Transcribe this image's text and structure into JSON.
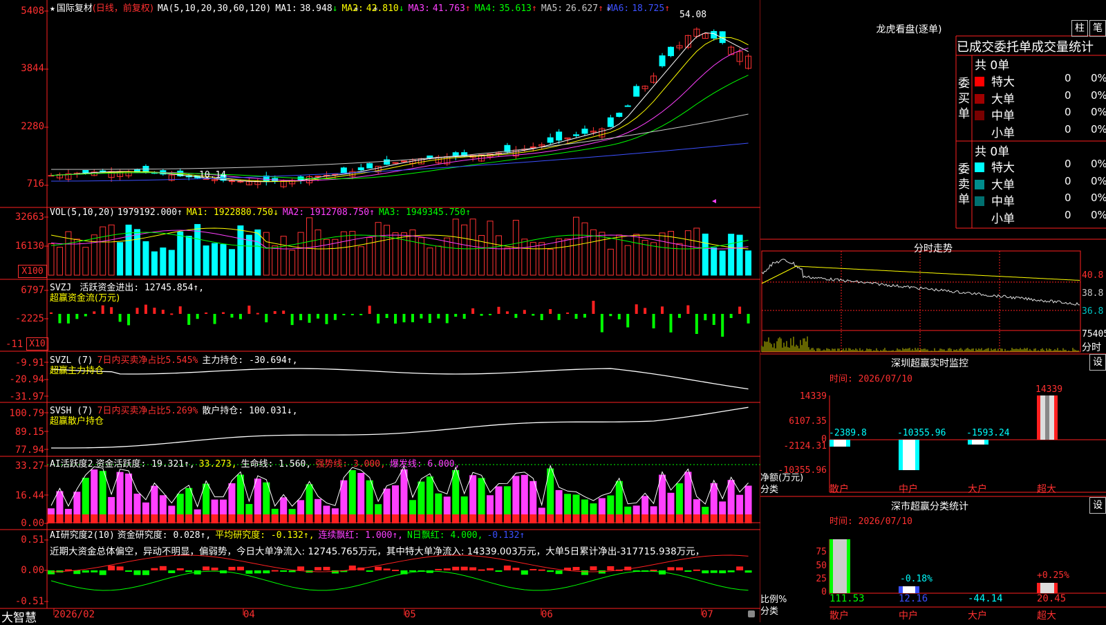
{
  "app_name": "大智慧",
  "kline": {
    "star": "★",
    "title": "国际复材",
    "mode": "(日线，前复权)",
    "ma_label": "MA(5,10,20,30,60,120)",
    "ma": [
      {
        "label": "MA1:",
        "value": "38.948",
        "arrow": "↓",
        "color": "#ffffff"
      },
      {
        "label": "MA2:",
        "value": "42.810",
        "arrow": "↓",
        "color": "#ffff00"
      },
      {
        "label": "MA3:",
        "value": "41.763",
        "arrow": "↑",
        "color": "#ff40ff"
      },
      {
        "label": "MA4:",
        "value": "35.613",
        "arrow": "↑",
        "color": "#00ff00"
      },
      {
        "label": "MA5:",
        "value": "26.627",
        "arrow": "↑",
        "color": "#c8c8c8"
      },
      {
        "label": "MA6:",
        "value": "18.725",
        "arrow": "↑",
        "color": "#3c50ff"
      }
    ],
    "y_ticks": [
      "5408",
      "3844",
      "2280",
      "716"
    ],
    "high_label": "54.08",
    "low_label": "10.14",
    "colors": {
      "up": "#ff3232",
      "down": "#00ffff"
    }
  },
  "vol": {
    "label": "VOL(5,10,20)",
    "value": "1979192.000↑",
    "ma1": "MA1: 1922880.750↓",
    "ma2": "MA2: 1912708.750↑",
    "ma3": "MA3: 1949345.750↑",
    "y_ticks": [
      "32663",
      "16130"
    ],
    "unit": "X100"
  },
  "svzj": {
    "label": "SVZJ",
    "text": "活跃资金进出: 12745.854↑,",
    "sub": "超赢资金流(万元)",
    "y_ticks": [
      "6797",
      "-2225",
      "-11"
    ],
    "unit": "X10"
  },
  "svzl": {
    "label": "SVZL (7)",
    "text1": "7日内买卖净占比5.545%",
    "text2": "主力持仓: -30.694↑,",
    "sub": "超赢主力持仓",
    "y_ticks": [
      "-9.91",
      "-20.94",
      "-31.97"
    ]
  },
  "svsh": {
    "label": "SVSH (7)",
    "text1": "7日内买卖净占比5.269%",
    "text2": "散户持仓: 100.031↓,",
    "sub": "超赢散户持仓",
    "y_ticks": [
      "100.79",
      "89.15",
      "77.94"
    ]
  },
  "ai2": {
    "label": "AI活跃度2",
    "t1": "资金活跃度: 19.321↑,",
    "t2": "33.273,",
    "t3": "生命线: 1.560,",
    "t4": "强势线: 3.000,",
    "t5": "爆发线: 6.000,",
    "y_ticks": [
      "33.27",
      "16.44",
      "0.00"
    ]
  },
  "ai_research": {
    "label": "AI研究度2(10)",
    "t1": "资金研究度: 0.028↑,",
    "t2": "平均研究度: -0.132↑,",
    "t3": "连续飘红: 1.000↑,",
    "t4": "N日飘红: 4.000,",
    "t5": "-0.132↑",
    "desc": "近期大资金总体偏空，异动不明显，偏弱势，今日大单净流入: 12745.765万元，其中特大单净流入: 14339.003万元，大单5日累计净出-317715.938万元，",
    "y_ticks": [
      "0.51",
      "0.00",
      "-0.51"
    ]
  },
  "x_axis": [
    "2026/02",
    "04",
    "05",
    "06",
    "07"
  ],
  "dragon": {
    "title": "龙虎看盘(逐单)",
    "btn1": "柱",
    "btn2": "笔",
    "header": "已成交委托单成交量统计",
    "buy_label": "委买单",
    "sell_label": "委卖单",
    "buy_total": "共 0单",
    "sell_total": "共 0单",
    "buy_rows": [
      {
        "name": "特大",
        "val": "0",
        "pct": "0%",
        "color": "#ff0000"
      },
      {
        "name": "大单",
        "val": "0",
        "pct": "0%",
        "color": "#a00000"
      },
      {
        "name": "中单",
        "val": "0",
        "pct": "0%",
        "color": "#780000"
      },
      {
        "name": "小单",
        "val": "0",
        "pct": "0%",
        "color": "#000000"
      }
    ],
    "sell_rows": [
      {
        "name": "特大",
        "val": "0",
        "pct": "0%",
        "color": "#00ffff"
      },
      {
        "name": "大单",
        "val": "0",
        "pct": "0%",
        "color": "#008c8c"
      },
      {
        "name": "中单",
        "val": "0",
        "pct": "0%",
        "color": "#007070"
      },
      {
        "name": "小单",
        "val": "0",
        "pct": "0%",
        "color": "#000000"
      }
    ]
  },
  "intraday": {
    "title": "分时走势",
    "y_ticks": [
      "40.8",
      "38.8",
      "36.8"
    ],
    "vol_label": "75405",
    "footer": "分时"
  },
  "monitor": {
    "title": "深圳超赢实时监控",
    "btn": "设",
    "time": "时间: 2026/07/10",
    "y_ticks": [
      "14339",
      "6107.35",
      "0",
      "-2124.31",
      "-10355.96"
    ],
    "bar_values": [
      "-2389.8",
      "-10355.96",
      "-1593.24",
      "14339"
    ],
    "unit_label": "净额(万元)",
    "class_label": "分类",
    "categories": [
      "散户",
      "中户",
      "大户",
      "超大"
    ]
  },
  "classify": {
    "title": "深市超赢分类统计",
    "btn": "设",
    "time": "时间: 2026/07/10",
    "y_ticks": [
      "75",
      "50",
      "25",
      "0"
    ],
    "pct_labels": [
      "-0.18%",
      "+0.25%"
    ],
    "bottom_values": [
      "111.53",
      "12.16",
      "-44.14",
      "20.45"
    ],
    "ratio_label": "比例%",
    "class_label": "分类",
    "categories": [
      "散户",
      "中户",
      "大户",
      "超大"
    ]
  }
}
